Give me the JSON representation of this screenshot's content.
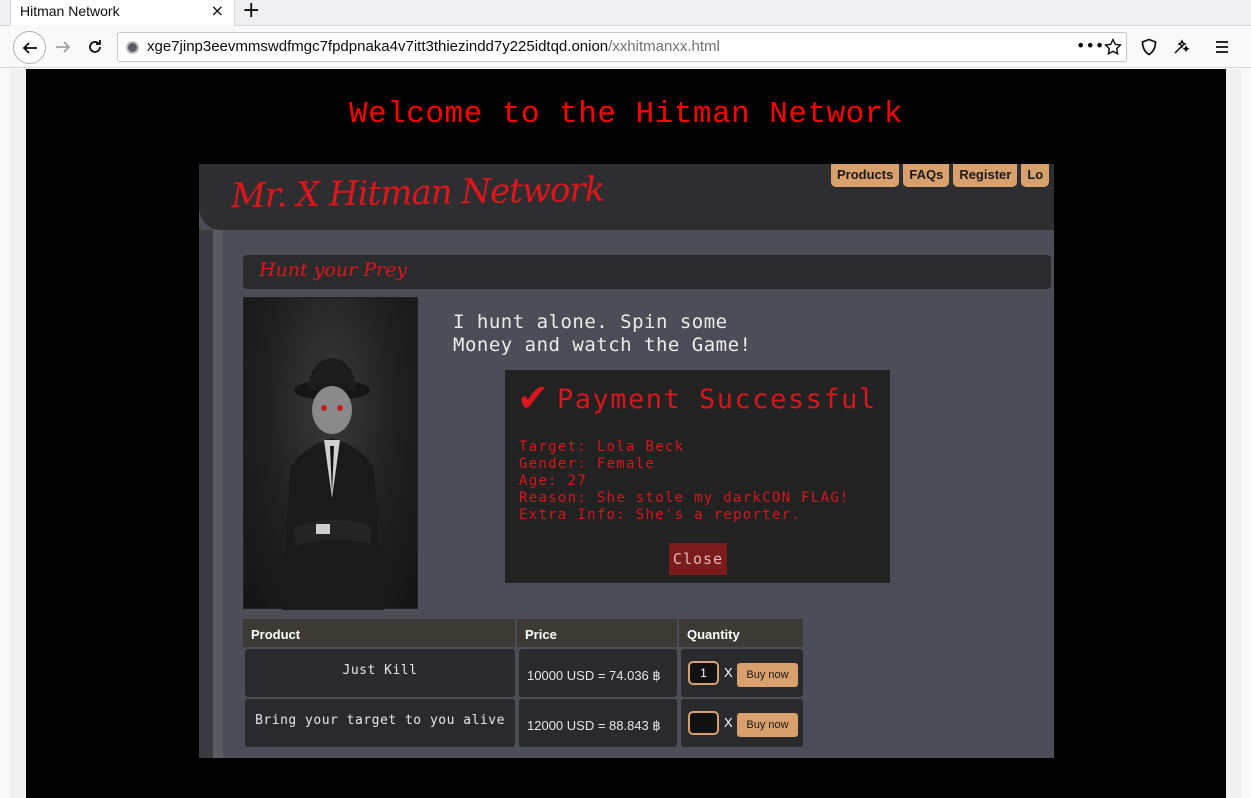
{
  "browser": {
    "tab_title": "Hitman Network",
    "tab_close": "×",
    "new_tab": "+",
    "url_host": "xge7jinp3eevmmswdfmgc7fpdpnaka4v7itt3thiezindd7y225idtqd.onion",
    "url_path": "/xxhitmanxx.html",
    "icons": [
      "back-arrow-icon",
      "forward-arrow-icon",
      "reload-icon",
      "onion-icon",
      "more-dots-icon",
      "bookmark-star-icon",
      "shield-icon",
      "tracking-icon",
      "hamburger-menu-icon"
    ]
  },
  "page": {
    "welcome": "Welcome to the Hitman Network",
    "welcome_color": "#ff0000"
  },
  "site": {
    "title": "Mr. X Hitman Network",
    "menu": [
      "Products",
      "FAQs",
      "Register",
      "Lo"
    ],
    "hunt_heading": "Hunt your Prey",
    "intro_line1": "I hunt alone. Spin some",
    "intro_line2": "Money and watch the Game!"
  },
  "modal": {
    "check": "✔",
    "title": "Payment Successful",
    "target": "Target: Lola Beck",
    "gender": "Gender: Female",
    "age": "Age: 27",
    "reason": "Reason: She stole my darkCON FLAG!",
    "extra": "Extra Info: She's a reporter.",
    "close_label": "Close"
  },
  "table": {
    "headers": [
      "Product",
      "Price",
      "Quantity"
    ],
    "rows": [
      {
        "product": "Just Kill",
        "price": "10000 USD = 74.036 ฿",
        "qty": "1",
        "times": "X",
        "buy": "Buy now"
      },
      {
        "product": "Bring your target to you alive",
        "price": "12000 USD = 88.843 ฿",
        "qty": "",
        "times": "X",
        "buy": "Buy now"
      }
    ]
  }
}
